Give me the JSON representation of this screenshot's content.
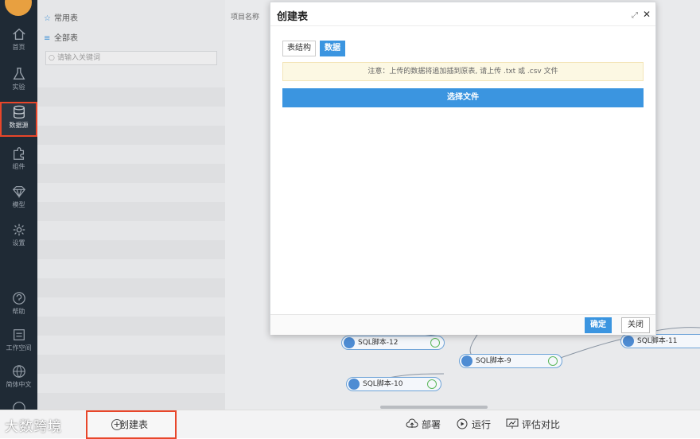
{
  "nav": {
    "items": [
      {
        "label": "首页",
        "icon": "home-icon"
      },
      {
        "label": "实验",
        "icon": "flask-icon"
      },
      {
        "label": "数据源",
        "icon": "database-icon"
      },
      {
        "label": "组件",
        "icon": "puzzle-icon"
      },
      {
        "label": "模型",
        "icon": "diamond-icon"
      },
      {
        "label": "设置",
        "icon": "gear-icon"
      },
      {
        "label": "帮助",
        "icon": "help-icon"
      },
      {
        "label": "工作空间",
        "icon": "workspace-icon"
      },
      {
        "label": "简体中文",
        "icon": "globe-icon"
      }
    ],
    "active": "数据源"
  },
  "left": {
    "common_tables": "常用表",
    "all_tables": "全部表",
    "search_placeholder": "请输入关键词"
  },
  "canvas": {
    "column_header": "项目名称",
    "nodes": [
      "SQL脚本-12",
      "SQL脚本-9",
      "SQL脚本-10",
      "SQL脚本-11"
    ]
  },
  "modal": {
    "title": "创建表",
    "tabs": [
      "表结构",
      "数据"
    ],
    "active_tab": "数据",
    "notice": "注意：上传的数据将追加插到原表, 请上传 .txt 或 .csv 文件",
    "choose_file": "选择文件",
    "confirm": "确定",
    "close": "关闭"
  },
  "bottom": {
    "brand": "大数跨境",
    "create_table": "创建表",
    "deploy": "部署",
    "run": "运行",
    "compare": "评估对比"
  },
  "colors": {
    "accent": "#3b95e0",
    "highlight": "#e8462a",
    "nav_bg": "#1f2a35"
  }
}
